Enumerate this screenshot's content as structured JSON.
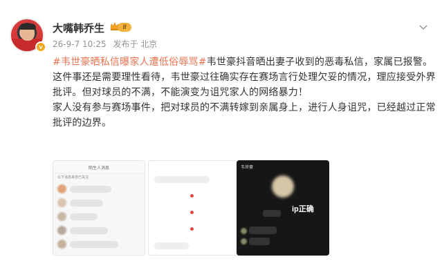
{
  "post": {
    "username": "大嘴韩乔生",
    "level_badge": "II",
    "verified_badge": "v",
    "meta": {
      "time": "26-9-7 10:25",
      "source": "发布于 北京"
    },
    "content": {
      "topic": "#韦世豪晒私信曝家人遭低俗辱骂#",
      "paragraph1_rest": "韦世豪抖音晒出妻子收到的恶毒私信，家属已报警。",
      "paragraph2": "这件事还是需要理性看待，韦世豪过往确实存在赛场言行处理欠妥的情况，理应接受外界批评。但对球员的不满，不能演变为诅咒家人的网络暴力！",
      "paragraph3": "家人没有参与赛场事件，把对球员的不满转嫁到亲属身上，进行人身诅咒，已经越过正常批评的边界。"
    },
    "images": {
      "img1_title": "陌生人消息",
      "img1_subtitle": "以下消息来自已关注",
      "img3_header": "韦世豪",
      "img3_ip": "ip正确"
    }
  },
  "icons": {
    "avatar": "avatar",
    "verified": "verified-v-icon",
    "crown": "crown-icon",
    "more": "more-options-icon"
  },
  "colors": {
    "topic": "#eb7350",
    "badge_gold": "#f2b33d"
  }
}
